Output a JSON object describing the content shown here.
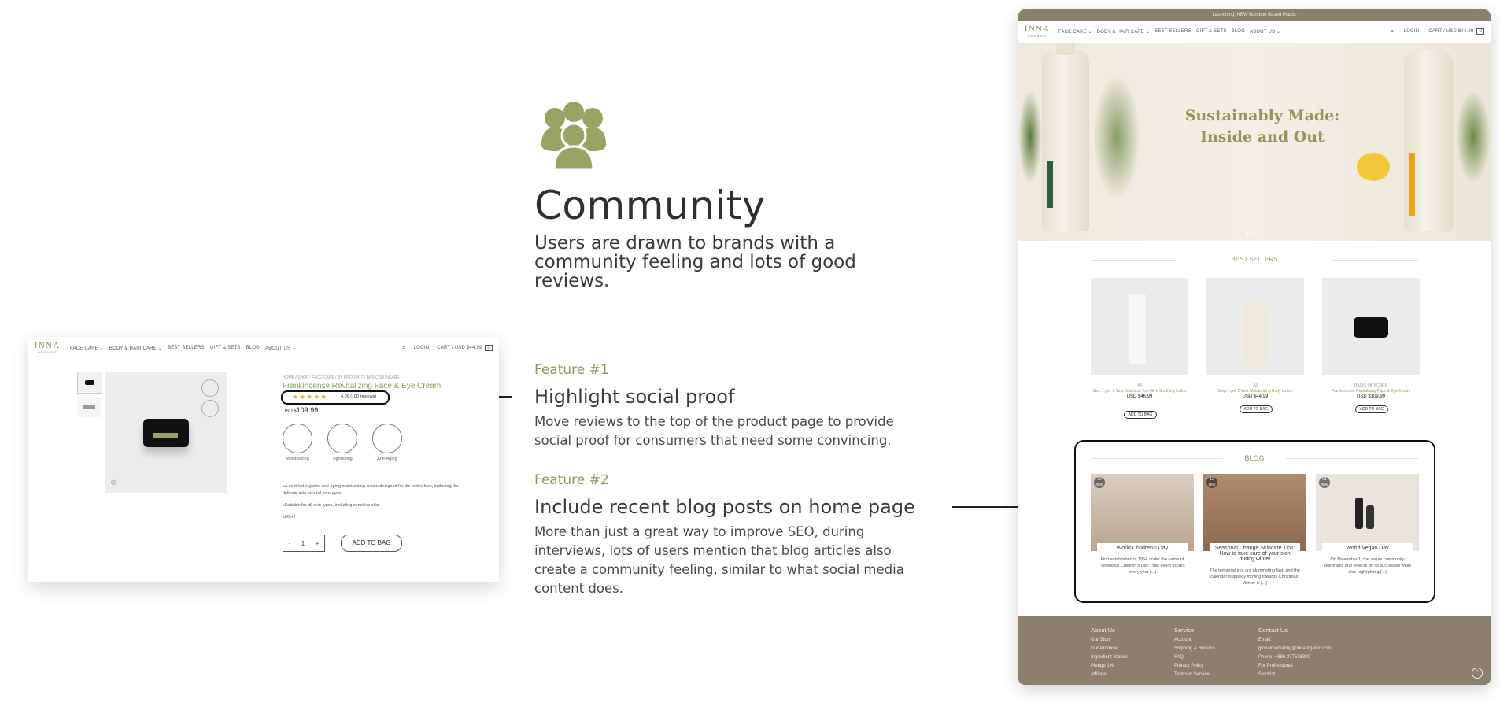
{
  "center": {
    "title": "Community",
    "subtitle": "Users are drawn to brands with a community feeling and lots of good reviews.",
    "icon": "community-icon",
    "accent": "#9aa366"
  },
  "features": [
    {
      "label": "Feature #1",
      "heading": "Highlight social proof",
      "body": "Move reviews to the top of the product page to provide social proof for consumers that need some convincing."
    },
    {
      "label": "Feature #2",
      "heading": "Include recent blog posts on home page",
      "body": "More than just a great way to improve SEO, during interviews, lots of users mention that blog articles also create a community feeling, similar to what social media content does."
    }
  ],
  "product_page": {
    "logo": "INNA",
    "logo_sub": "ORGANIC",
    "nav": [
      "FACE CARE ⌄",
      "BODY & HAIR CARE ⌄",
      "BEST SELLERS",
      "GIFT & SETS",
      "BLOG",
      "ABOUT US ⌄"
    ],
    "login": "LOGIN",
    "cart": "CART / USD $44.99",
    "cart_count": "0",
    "breadcrumb": "HOME / SHOP / FACE CARE / BY PRODUCT / BASIC SKINCARE",
    "product_title": "Frankincense Revitalizing Face & Eye Cream",
    "stars": "★★★★★",
    "rating": "4.09 (100 reviews)",
    "price_currency": "USD $",
    "price": "109.99",
    "benefits": [
      "Moisturizing",
      "Tightening",
      "Anti-Aging"
    ],
    "bullets": [
      "A certified-organic, anti-aging moisturizing cream designed for the entire face, including the delicate skin around your eyes.",
      "Suitable for all skin types, including sensitive skin.",
      "50 ml"
    ],
    "qty_minus": "-",
    "qty": "1",
    "qty_plus": "+",
    "add_to_bag": "ADD TO BAG"
  },
  "homepage": {
    "promo": "Launching: NEW Bamboo Based Plastic",
    "logo": "INNA",
    "logo_sub": "ORGANIC",
    "nav": [
      "FACE CARE ⌄",
      "BODY & HAIR CARE ⌄",
      "BEST SELLERS",
      "GIFT & SETS",
      "BLOG",
      "ABOUT US ⌄"
    ],
    "login": "LOGIN",
    "cart": "CART / USD $44.99",
    "cart_count": "0",
    "hero_line1": "Sustainably Made:",
    "hero_line2": "Inside and Out",
    "best_sellers_title": "BEST SELLERS",
    "products": [
      {
        "cat": "All",
        "name": "Step 1 gel: 5 Vets Botanical Tea Olive Soothing Lotion",
        "price": "USD $46.99",
        "cta": "ADD TO BAG"
      },
      {
        "cat": "All",
        "name": "Step 1 gel: 5 Vets Moisturizing Body Lotion",
        "price": "USD $44.99",
        "cta": "ADD TO BAG"
      },
      {
        "cat": "BASIC SKINCARE",
        "name": "Frankincense Revitalizing Face & Eye Cream",
        "price": "USD $109.99",
        "cta": "ADD TO BAG"
      }
    ],
    "blog_title": "BLOG",
    "posts": [
      {
        "day": "20",
        "mon": "Nov",
        "title": "World Children's Day",
        "excerpt": "First established in 1954 under the name of \"Universal Children's Day\", this event occurs every year [...]",
        "color": "#b9a58e"
      },
      {
        "day": "12",
        "mon": "Nov",
        "title": "Seasonal Change Skincare Tips: How to take care of your skin during winter",
        "excerpt": "The temperatures are plummeting fast, and the calendar is quickly moving towards Christmas. Winter is [...]",
        "color": "#8a6a52"
      },
      {
        "day": "01",
        "mon": "Nov",
        "title": "World Vegan Day",
        "excerpt": "On November 1, the vegan community celebrates and reflects on its successes while also highlighting [...]",
        "color": "#e9e5dc"
      }
    ],
    "footer": {
      "about": {
        "heading": "About Us",
        "links": [
          "Our Story",
          "Our Promise",
          "Ingredient Stories",
          "Pledge 1%",
          "Affiliate"
        ]
      },
      "service": {
        "heading": "Service",
        "links": [
          "Account",
          "Shipping & Returns",
          "FAQ",
          "Privacy Policy",
          "Terms of Service"
        ]
      },
      "contact": {
        "heading": "Contact Us",
        "links": [
          "Email:",
          "globalmarketing@innaorganic.com",
          "Phone: +886 277516300",
          "For Professional",
          "Stockist"
        ]
      }
    }
  }
}
